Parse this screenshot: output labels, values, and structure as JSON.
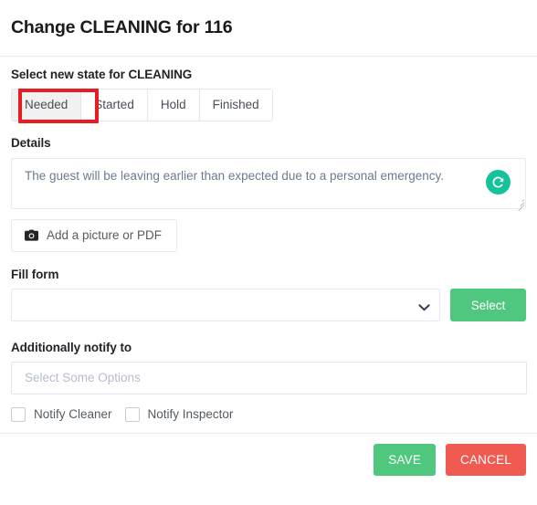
{
  "header": {
    "title": "Change CLEANING for 116"
  },
  "state_section": {
    "label": "Select new state for CLEANING",
    "options": [
      {
        "label": "Needed",
        "active": true
      },
      {
        "label": "Started",
        "active": false
      },
      {
        "label": "Hold",
        "active": false
      },
      {
        "label": "Finished",
        "active": false
      }
    ],
    "highlight_color": "#e81c23"
  },
  "details_section": {
    "label": "Details",
    "value": "The guest will be leaving earlier than expected due to a personal emergency.",
    "placeholder": "",
    "grammarly_glyph": "G",
    "grammarly_color": "#15c39a",
    "attach_button": {
      "label": "Add a picture or PDF",
      "icon": "camera-icon"
    }
  },
  "fill_form_section": {
    "label": "Fill form",
    "select_value": "",
    "select_options": [
      ""
    ],
    "select_button_label": "Select",
    "select_button_color": "#4fc77f"
  },
  "notify_section": {
    "label": "Additionally notify to",
    "multiselect_placeholder": "Select Some Options",
    "checkboxes": [
      {
        "label": "Notify Cleaner",
        "checked": false
      },
      {
        "label": "Notify Inspector",
        "checked": false
      }
    ]
  },
  "footer": {
    "save_label": "SAVE",
    "cancel_label": "CANCEL",
    "save_color": "#4fc77f",
    "cancel_color": "#ef5b50"
  }
}
